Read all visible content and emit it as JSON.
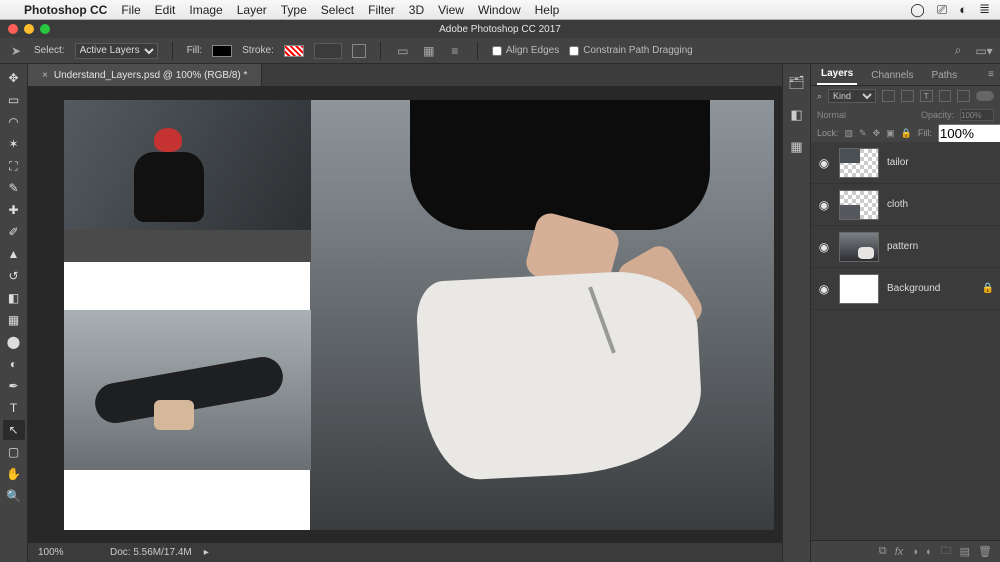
{
  "mac_menu": {
    "app": "Photoshop CC",
    "items": [
      "File",
      "Edit",
      "Image",
      "Layer",
      "Type",
      "Select",
      "Filter",
      "3D",
      "View",
      "Window",
      "Help"
    ]
  },
  "window": {
    "title": "Adobe Photoshop CC 2017"
  },
  "options": {
    "select_label": "Select:",
    "select_value": "Active Layers",
    "fill_label": "Fill:",
    "stroke_label": "Stroke:",
    "stroke_width": "",
    "align_edges": "Align Edges",
    "constrain": "Constrain Path Dragging"
  },
  "doc": {
    "tab": "Understand_Layers.psd @ 100% (RGB/8) *"
  },
  "status": {
    "zoom": "100%",
    "doc_info": "Doc: 5.56M/17.4M"
  },
  "panels": {
    "tabs": [
      "Layers",
      "Channels",
      "Paths"
    ],
    "kind_label": "Kind",
    "blend_mode": "Normal",
    "opacity_label": "Opacity:",
    "opacity_value": "100%",
    "lock_label": "Lock:",
    "fill_label": "Fill:",
    "fill_value": "100%",
    "layers": [
      {
        "name": "tailor",
        "locked": false
      },
      {
        "name": "cloth",
        "locked": false
      },
      {
        "name": "pattern",
        "locked": false
      },
      {
        "name": "Background",
        "locked": true
      }
    ],
    "bottom_icons": [
      "link",
      "fx",
      "mask",
      "adjust",
      "group",
      "new",
      "trash"
    ]
  },
  "tools": [
    "move",
    "marquee",
    "lasso",
    "quick-select",
    "crop",
    "eyedrop",
    "patch",
    "brush",
    "stamp",
    "history",
    "eraser",
    "gradient",
    "blur",
    "dodge",
    "pen",
    "type",
    "path-select",
    "rectangle",
    "hand",
    "zoom"
  ]
}
